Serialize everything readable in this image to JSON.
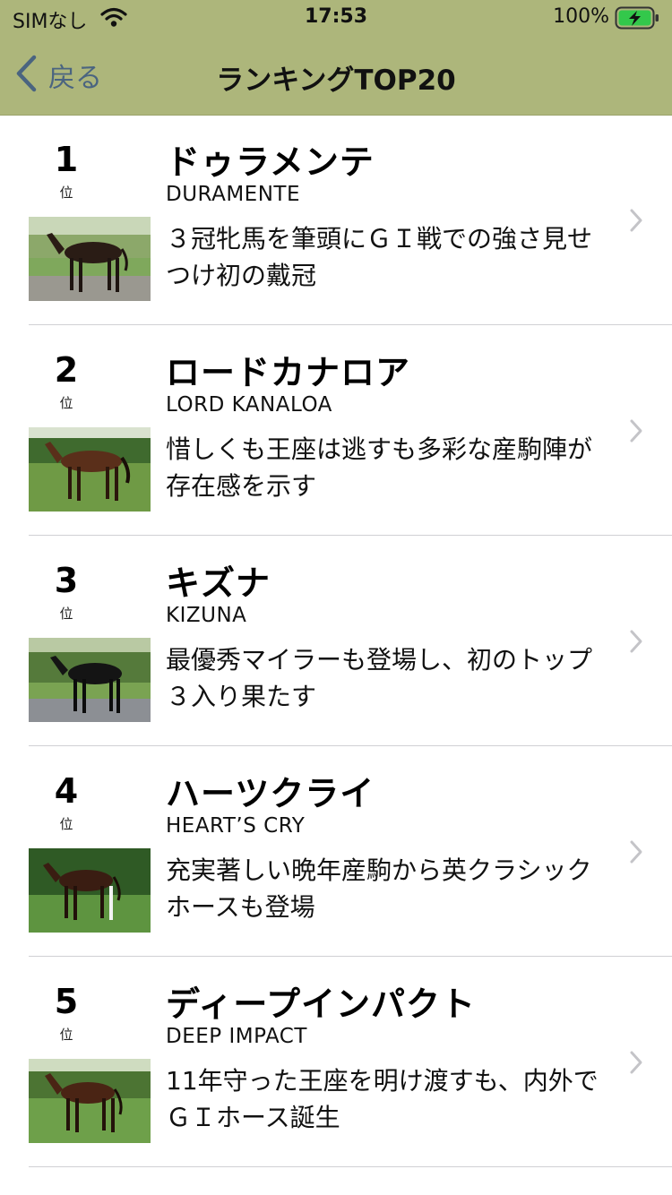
{
  "status_bar": {
    "carrier": "SIMなし",
    "time": "17:53",
    "battery": "100%"
  },
  "nav": {
    "back_label": "戻る",
    "title": "ランキングTOP20"
  },
  "colors": {
    "nav_background": "#adb67b",
    "back_tint": "#4a6480"
  },
  "rank_unit": "位",
  "items": [
    {
      "rank": "1",
      "name_jp": "ドゥラメンテ",
      "name_en": "DURAMENTE",
      "description": "３冠牝馬を筆頭にＧＩ戦での強さ見せつけ初の戴冠"
    },
    {
      "rank": "2",
      "name_jp": "ロードカナロア",
      "name_en": "LORD KANALOA",
      "description": "惜しくも王座は逃すも多彩な産駒陣が存在感を示す"
    },
    {
      "rank": "3",
      "name_jp": "キズナ",
      "name_en": "KIZUNA",
      "description": "最優秀マイラーも登場し、初のトップ３入り果たす"
    },
    {
      "rank": "4",
      "name_jp": "ハーツクライ",
      "name_en": "HEART’S CRY",
      "description": "充実著しい晩年産駒から英クラシックホースも登場"
    },
    {
      "rank": "5",
      "name_jp": "ディープインパクト",
      "name_en": "DEEP IMPACT",
      "description": "11年守った王座を明け渡すも、内外でＧＩホース誕生"
    }
  ]
}
